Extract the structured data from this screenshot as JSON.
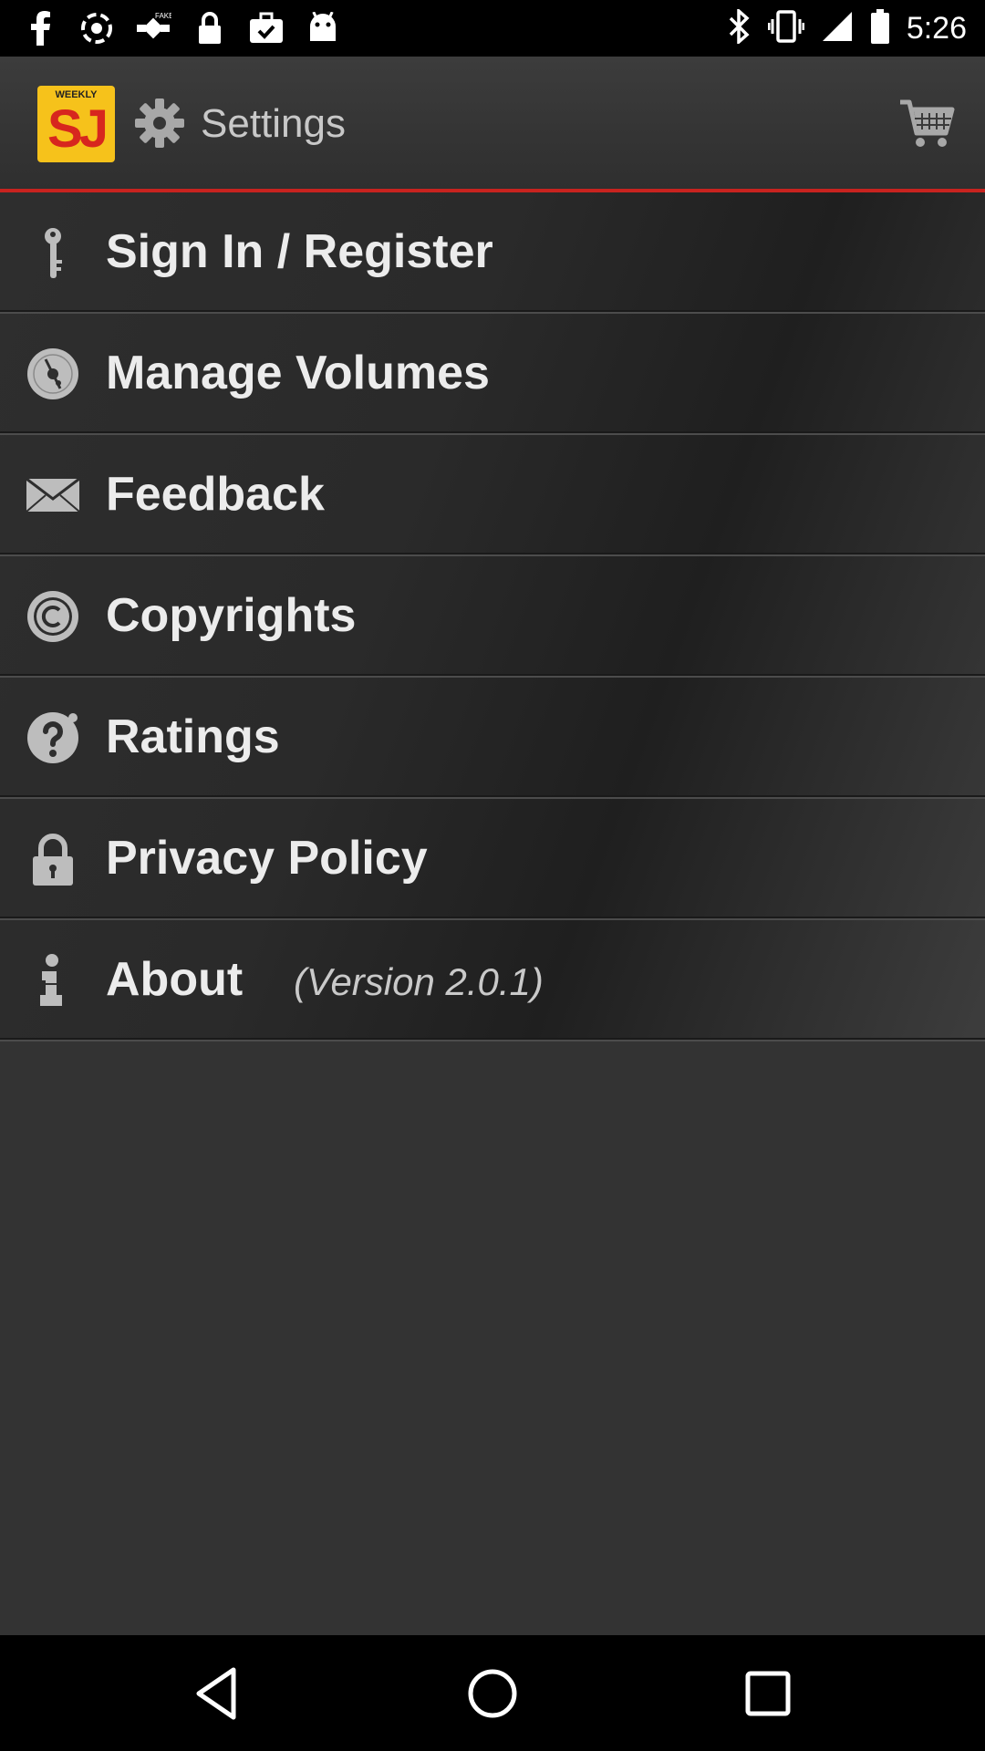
{
  "status_bar": {
    "time": "5:26",
    "left_icons": [
      "facebook-icon",
      "sync-icon",
      "fake-gps-icon",
      "lock-icon",
      "briefcase-check-icon",
      "android-icon"
    ],
    "right_icons": [
      "bluetooth-icon",
      "vibrate-icon",
      "signal-icon",
      "battery-icon"
    ]
  },
  "header": {
    "logo_small_text": "WEEKLY",
    "logo_text": "SJ",
    "title": "Settings",
    "icons": {
      "settings": "gear-icon",
      "cart": "shopping-cart-icon"
    },
    "accent_color": "#c8231f",
    "logo_color": "#f6c21b"
  },
  "menu": {
    "items": [
      {
        "label": "Sign In / Register",
        "icon": "key-icon"
      },
      {
        "label": "Manage Volumes",
        "icon": "disc-icon"
      },
      {
        "label": "Feedback",
        "icon": "envelope-icon"
      },
      {
        "label": "Copyrights",
        "icon": "copyright-icon"
      },
      {
        "label": "Ratings",
        "icon": "question-icon"
      },
      {
        "label": "Privacy Policy",
        "icon": "padlock-icon"
      },
      {
        "label": "About",
        "icon": "info-icon",
        "version": "(Version 2.0.1)"
      }
    ]
  },
  "nav_bar": {
    "buttons": [
      "back-button",
      "home-button",
      "recents-button"
    ]
  }
}
